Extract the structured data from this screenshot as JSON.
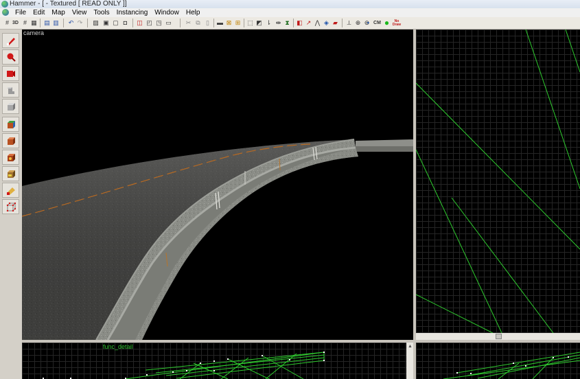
{
  "window": {
    "title": "Hammer - [ - Textured [ READ ONLY ]]"
  },
  "menu": {
    "items": [
      "File",
      "Edit",
      "Map",
      "View",
      "Tools",
      "Instancing",
      "Window",
      "Help"
    ]
  },
  "toolbar": {
    "buttons": [
      {
        "name": "grid-icon"
      },
      {
        "name": "3d-grid-icon",
        "label": "3D"
      },
      {
        "name": "smaller-grid-icon"
      },
      {
        "name": "larger-grid-icon"
      },
      {
        "name": "copy-icon"
      },
      {
        "name": "paste-icon"
      },
      {
        "name": "undo-icon"
      },
      {
        "name": "redo-icon"
      },
      {
        "name": "carve-icon"
      },
      {
        "name": "group-icon"
      },
      {
        "name": "ungroup-icon"
      },
      {
        "name": "hide-icon"
      },
      {
        "name": "cordon-icon"
      },
      {
        "name": "texture-lock-icon"
      },
      {
        "name": "texture-scale-icon"
      },
      {
        "name": "cut-icon"
      },
      {
        "name": "copy2-icon"
      },
      {
        "name": "paste2-icon"
      },
      {
        "name": "tie-entity-icon"
      },
      {
        "name": "toworld-icon"
      },
      {
        "name": "select-icon"
      },
      {
        "name": "vertex-icon"
      },
      {
        "name": "flip-h-icon"
      },
      {
        "name": "flip-v-icon"
      },
      {
        "name": "run-map-icon"
      },
      {
        "name": "entity-report-icon"
      },
      {
        "name": "check-problems-icon"
      },
      {
        "name": "sound-icon"
      },
      {
        "name": "displacement-icon"
      },
      {
        "name": "overlay-icon"
      },
      {
        "name": "cm-icon",
        "label": "CM"
      },
      {
        "name": "green-leaf-icon"
      },
      {
        "name": "no-draw-icon",
        "label": "No Draw"
      }
    ]
  },
  "tools": [
    {
      "name": "selection-tool-icon"
    },
    {
      "name": "magnify-tool-icon"
    },
    {
      "name": "camera-tool-icon"
    },
    {
      "name": "entity-tool-icon"
    },
    {
      "name": "block-tool-icon"
    },
    {
      "name": "texture-app-icon"
    },
    {
      "name": "apply-texture-icon"
    },
    {
      "name": "decal-tool-icon"
    },
    {
      "name": "overlay-tool-icon"
    },
    {
      "name": "clipping-tool-icon"
    },
    {
      "name": "vertex-tool-icon"
    }
  ],
  "viewport3d": {
    "label": "camera"
  },
  "viewport2d_bottom": {
    "label": "func_detail"
  },
  "colors": {
    "brush_lines": "#2ecc2e",
    "grid": "#252525",
    "background": "#000000"
  }
}
